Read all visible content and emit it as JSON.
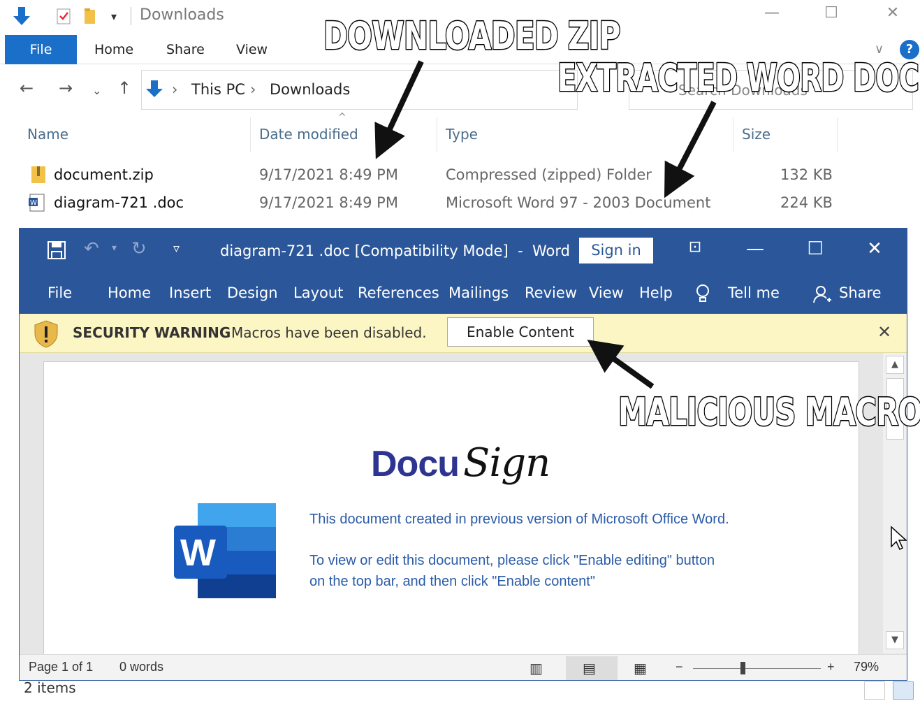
{
  "explorer": {
    "window_title": "Downloads",
    "tabs": {
      "file": "File",
      "home": "Home",
      "share": "Share",
      "view": "View"
    },
    "help": "?",
    "address": {
      "this_pc": "This PC",
      "downloads": "Downloads"
    },
    "search_placeholder": "Search Downloads",
    "columns": {
      "name": "Name",
      "date": "Date modified",
      "type": "Type",
      "size": "Size"
    },
    "files": [
      {
        "name": "document.zip",
        "date": "9/17/2021 8:49 PM",
        "type": "Compressed (zipped) Folder",
        "size": "132 KB"
      },
      {
        "name": "diagram-721 .doc",
        "date": "9/17/2021 8:49 PM",
        "type": "Microsoft Word 97 - 2003 Document",
        "size": "224 KB"
      }
    ],
    "status": "2 items"
  },
  "word": {
    "title": "diagram-721 .doc [Compatibility Mode]  -  Word",
    "sign_in": "Sign in",
    "tabs": {
      "file": "File",
      "home": "Home",
      "insert": "Insert",
      "design": "Design",
      "layout": "Layout",
      "references": "References",
      "mailings": "Mailings",
      "review": "Review",
      "view": "View",
      "help": "Help",
      "tell_me": "Tell me",
      "share": "Share"
    },
    "warning": {
      "label": "SECURITY WARNING",
      "message": "Macros have been disabled.",
      "button": "Enable Content",
      "close": "✕"
    },
    "document": {
      "logo_docu": "Docu",
      "logo_sign": "Sign",
      "word_icon_letter": "W",
      "line1": "This document created in previous version of Microsoft Office Word.",
      "line2": "To view or edit this document, please click \"Enable editing\" button",
      "line3": "on the top bar, and then click \"Enable content\""
    },
    "statusbar": {
      "page": "Page 1 of 1",
      "words": "0 words",
      "zoom": "79%"
    }
  },
  "annotations": {
    "zip": "DOWNLOADED ZIP",
    "doc": "EXTRACTED WORD DOC",
    "macro": "MALICIOUS MACRO"
  },
  "colors": {
    "word_blue": "#2b579a",
    "explorer_blue": "#1a6fc9",
    "warning_bg": "#fcf5c4",
    "docusign_blue": "#2e3591"
  }
}
